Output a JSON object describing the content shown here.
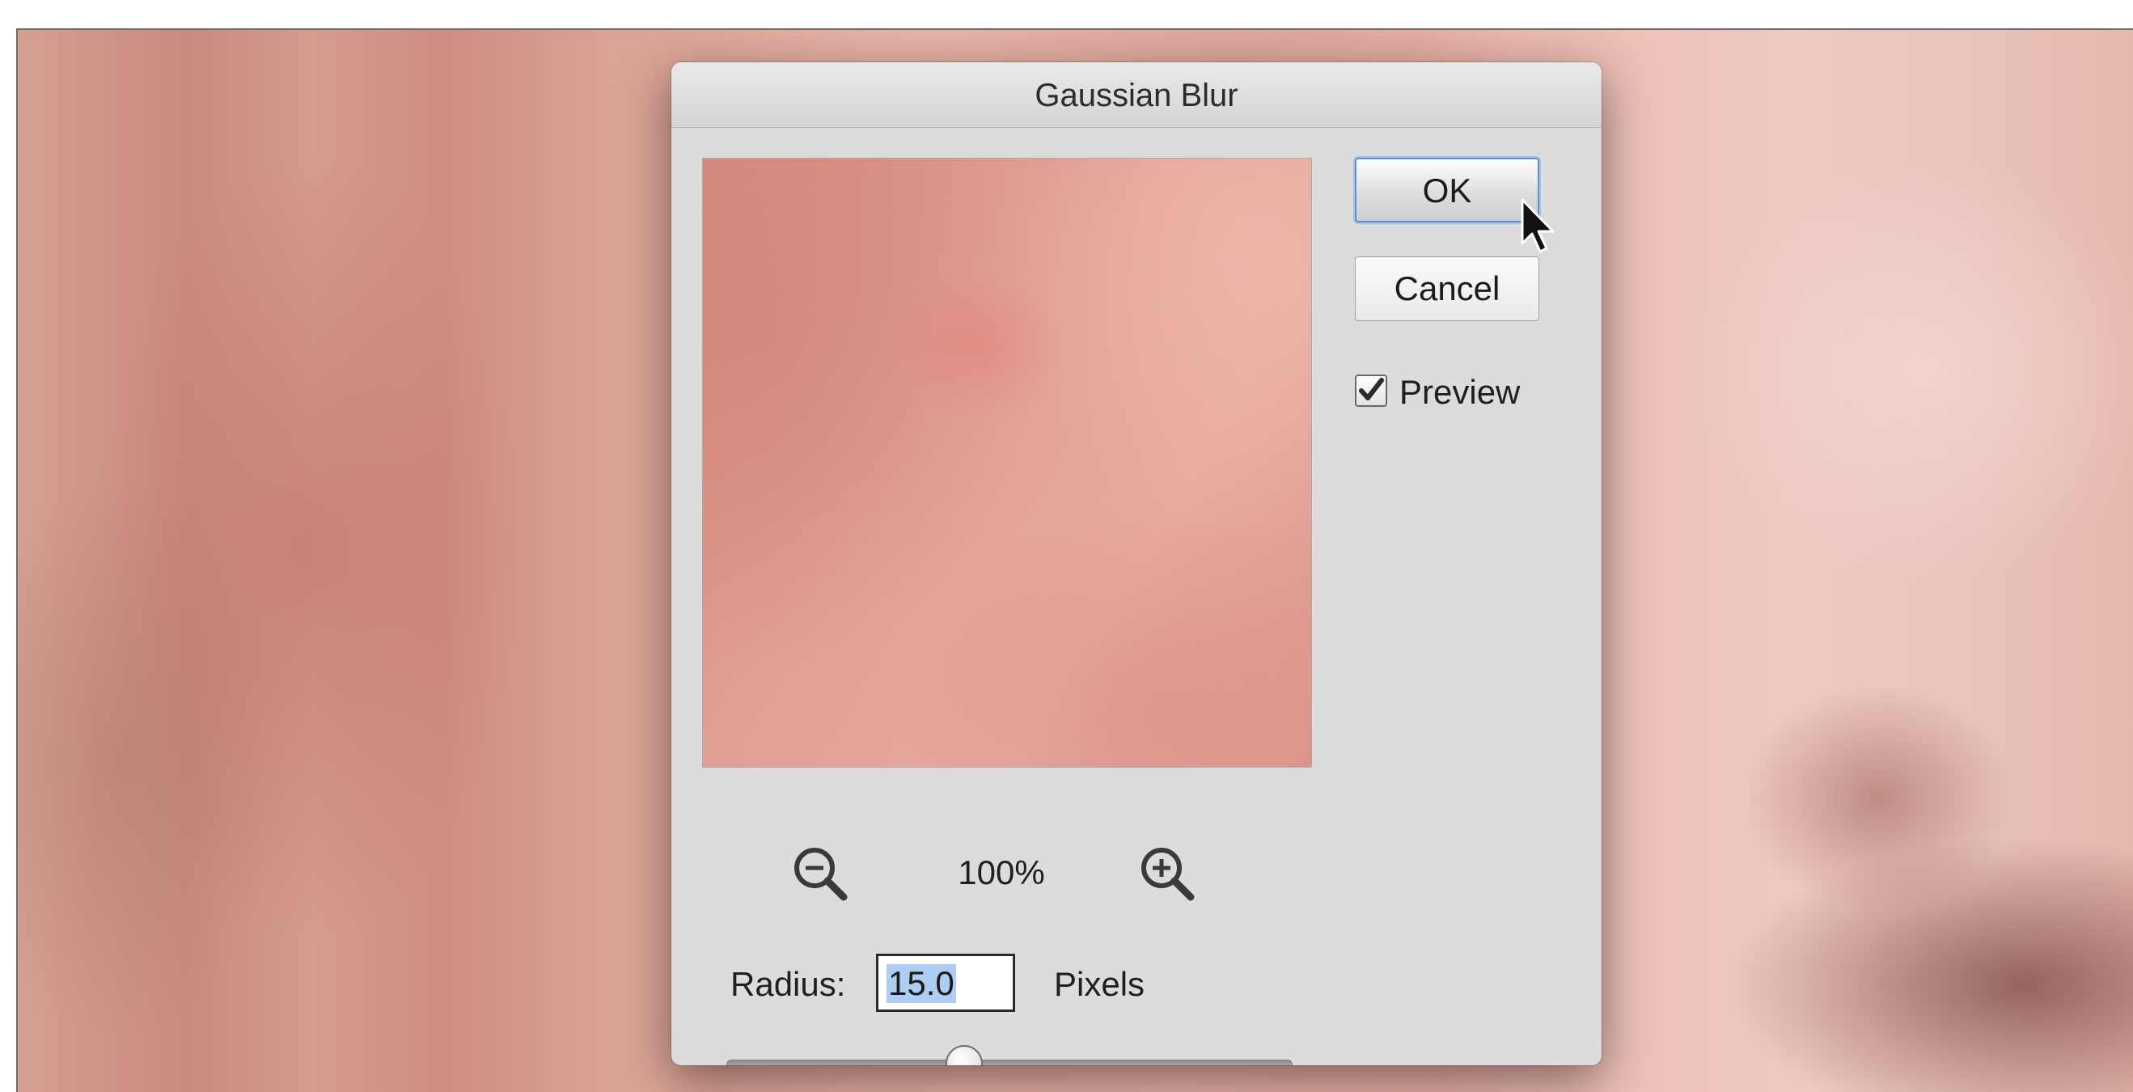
{
  "dialog": {
    "title": "Gaussian Blur",
    "ok_label": "OK",
    "cancel_label": "Cancel",
    "preview_label": "Preview",
    "preview_checked": true,
    "zoom_level": "100%",
    "radius_label": "Radius:",
    "radius_value": "15.0",
    "radius_unit": "Pixels",
    "radius_slider_fraction": 0.42
  },
  "icons": {
    "zoom_out": "zoom-out-icon",
    "zoom_in": "zoom-in-icon",
    "cursor": "mouse-pointer-icon",
    "checkmark": "checkmark-icon"
  },
  "colors": {
    "dialog_bg": "#dcdcdc",
    "default_button_ring": "#5d8fd6",
    "selection_highlight": "#aecdf2"
  }
}
